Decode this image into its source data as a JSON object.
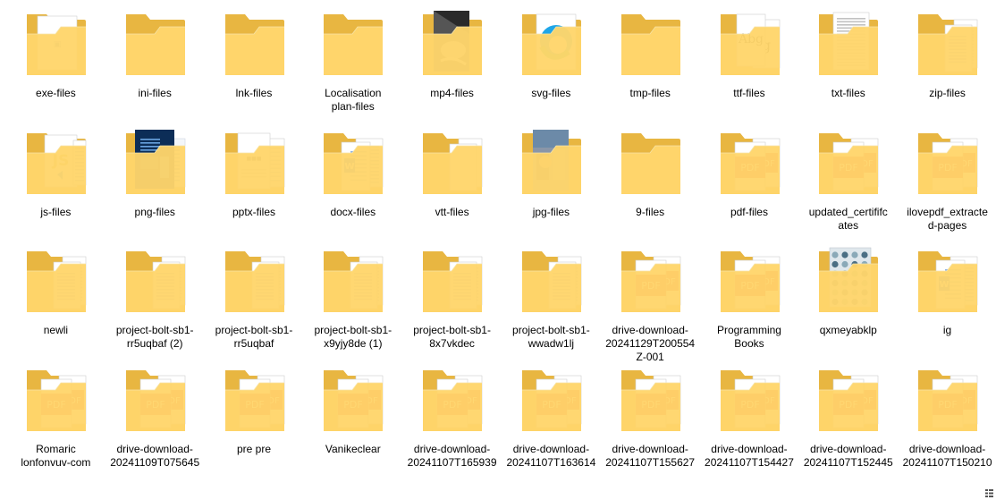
{
  "folders": [
    {
      "name": "exe-files",
      "preview": "exe"
    },
    {
      "name": "ini-files",
      "preview": "empty"
    },
    {
      "name": "lnk-files",
      "preview": "empty"
    },
    {
      "name": "Localisation\nplan-files",
      "preview": "empty"
    },
    {
      "name": "mp4-files",
      "preview": "photo"
    },
    {
      "name": "svg-files",
      "preview": "edge"
    },
    {
      "name": "tmp-files",
      "preview": "empty"
    },
    {
      "name": "ttf-files",
      "preview": "font",
      "preview_text": "Abg"
    },
    {
      "name": "txt-files",
      "preview": "text"
    },
    {
      "name": "zip-files",
      "preview": "doc"
    },
    {
      "name": "js-files",
      "preview": "js",
      "preview_text": "JS"
    },
    {
      "name": "png-files",
      "preview": "blueprint"
    },
    {
      "name": "pptx-files",
      "preview": "pptx"
    },
    {
      "name": "docx-files",
      "preview": "word"
    },
    {
      "name": "vtt-files",
      "preview": "pages"
    },
    {
      "name": "jpg-files",
      "preview": "photo2"
    },
    {
      "name": "9-files",
      "preview": "empty"
    },
    {
      "name": "pdf-files",
      "preview": "pdf",
      "preview_text": "PDF"
    },
    {
      "name": "updated_certififc\nates",
      "preview": "pdf",
      "preview_text": "PDF"
    },
    {
      "name": "ilovepdf_extracte\nd-pages",
      "preview": "pdf",
      "preview_text": "PDF"
    },
    {
      "name": "newli",
      "preview": "doc"
    },
    {
      "name": "project-bolt-sb1-\nrr5uqbaf (2)",
      "preview": "doc"
    },
    {
      "name": "project-bolt-sb1-\nrr5uqbaf",
      "preview": "doc"
    },
    {
      "name": "project-bolt-sb1-\nx9yjy8de (1)",
      "preview": "doc"
    },
    {
      "name": "project-bolt-sb1-\n8x7vkdec",
      "preview": "doc"
    },
    {
      "name": "project-bolt-sb1-\nwwadw1lj",
      "preview": "doc"
    },
    {
      "name": "drive-download-\n20241129T200554\nZ-001",
      "preview": "pdf",
      "preview_text": "PDF"
    },
    {
      "name": "Programming\nBooks",
      "preview": "pdf",
      "preview_text": "PDF"
    },
    {
      "name": "qxmeyabklp",
      "preview": "pattern"
    },
    {
      "name": "ig",
      "preview": "word"
    },
    {
      "name": "Romaric\nlonfonvuv-com",
      "preview": "pdf",
      "preview_text": "PDF"
    },
    {
      "name": "drive-download-\n20241109T075645",
      "preview": "pdf",
      "preview_text": "PDF"
    },
    {
      "name": "pre pre",
      "preview": "pdf",
      "preview_text": "PDF"
    },
    {
      "name": "Vanikeclear",
      "preview": "pdf",
      "preview_text": "PDF"
    },
    {
      "name": "drive-download-\n20241107T165939",
      "preview": "pdf",
      "preview_text": "PDF"
    },
    {
      "name": "drive-download-\n20241107T163614",
      "preview": "pdf",
      "preview_text": "PDF"
    },
    {
      "name": "drive-download-\n20241107T155627",
      "preview": "pdf",
      "preview_text": "PDF"
    },
    {
      "name": "drive-download-\n20241107T154427",
      "preview": "pdf",
      "preview_text": "PDF"
    },
    {
      "name": "drive-download-\n20241107T152445",
      "preview": "pdf",
      "preview_text": "PDF"
    },
    {
      "name": "drive-download-\n20241107T150210",
      "preview": "pdf",
      "preview_text": "PDF"
    }
  ],
  "colors": {
    "folder_back": "#E8B641",
    "folder_front": "#FFD56B",
    "pdf_red": "#D81E1E",
    "word_blue": "#2B6CD4",
    "js_yellow": "#C9A318",
    "hover": "#E5F3FF"
  }
}
